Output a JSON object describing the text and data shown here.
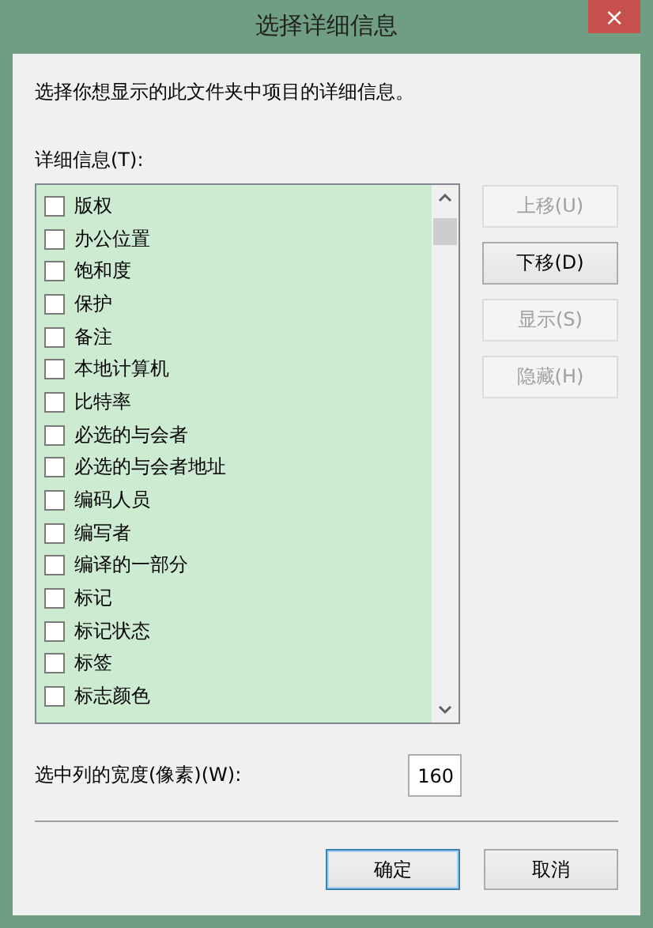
{
  "window": {
    "title": "选择详细信息",
    "close": "×"
  },
  "description": "选择你想显示的此文件夹中项目的详细信息。",
  "details_label": "详细信息(T):",
  "details": [
    {
      "label": "版权",
      "checked": false
    },
    {
      "label": "办公位置",
      "checked": false
    },
    {
      "label": "饱和度",
      "checked": false
    },
    {
      "label": "保护",
      "checked": false
    },
    {
      "label": "备注",
      "checked": false
    },
    {
      "label": "本地计算机",
      "checked": false
    },
    {
      "label": "比特率",
      "checked": false
    },
    {
      "label": "必选的与会者",
      "checked": false
    },
    {
      "label": "必选的与会者地址",
      "checked": false
    },
    {
      "label": "编码人员",
      "checked": false
    },
    {
      "label": "编写者",
      "checked": false
    },
    {
      "label": "编译的一部分",
      "checked": false
    },
    {
      "label": "标记",
      "checked": false
    },
    {
      "label": "标记状态",
      "checked": false
    },
    {
      "label": "标签",
      "checked": false
    },
    {
      "label": "标志颜色",
      "checked": false
    }
  ],
  "side_buttons": [
    {
      "label": "上移(U)",
      "disabled": true
    },
    {
      "label": "下移(D)",
      "disabled": false
    },
    {
      "label": "显示(S)",
      "disabled": true
    },
    {
      "label": "隐藏(H)",
      "disabled": true
    }
  ],
  "width_label": "选中列的宽度(像素)(W):",
  "width_value": "160",
  "buttons": [
    {
      "label": "确定",
      "focused": true
    },
    {
      "label": "取消",
      "focused": false
    }
  ]
}
